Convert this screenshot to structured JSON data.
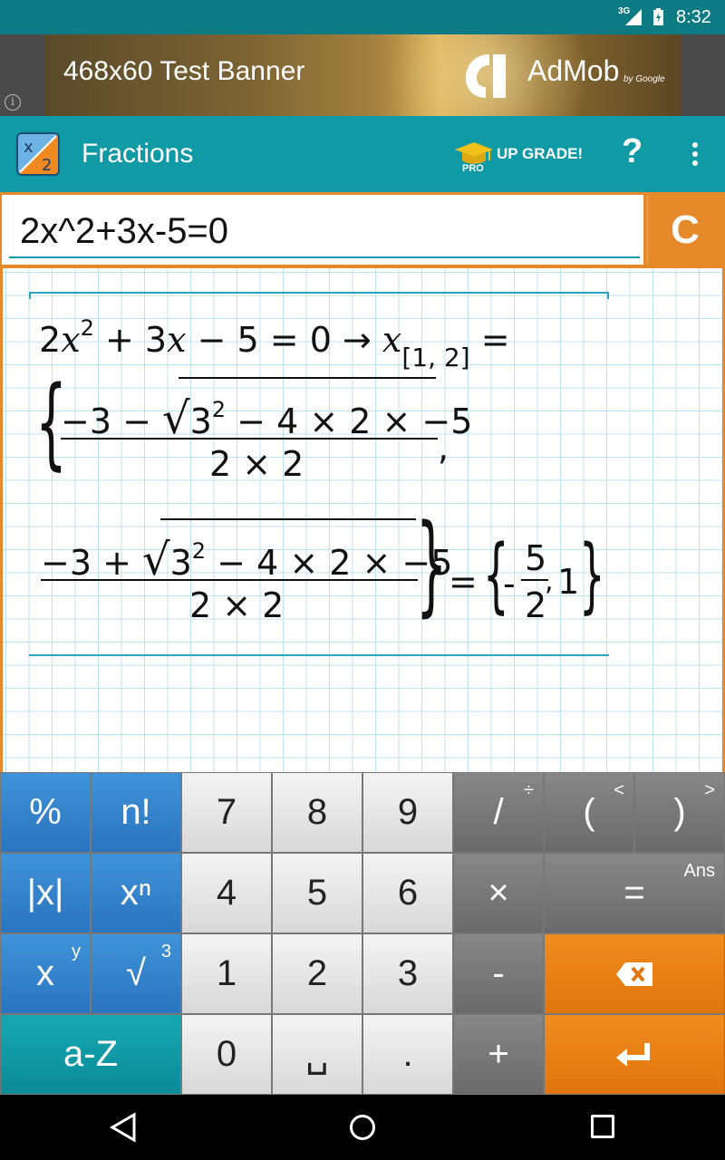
{
  "status_bar": {
    "network": "3G",
    "time": "8:32"
  },
  "ad": {
    "size_text": "468x60  Test Banner",
    "brand": "AdMob",
    "by": "by Google",
    "info": "i"
  },
  "app_bar": {
    "title": "Fractions",
    "upgrade_label": "UP GRADE!",
    "pro_label": "PRO",
    "help_label": "?"
  },
  "input": {
    "expression": "2x^2+3x-5=0",
    "clear_label": "C"
  },
  "result": {
    "line1": {
      "lhs_a": "2",
      "var": "x",
      "exp": "2",
      "rest": " + 3",
      "var2": "x",
      "rest2": " − 5 = 0  →  ",
      "xvar": "x",
      "sub": "[1, 2]",
      "eq": " ="
    },
    "frac1": {
      "numerator_left": "−3 − ",
      "radicand_base": "3",
      "radicand_exp": "2",
      "radicand_rest": " − 4 × 2 × −5",
      "denominator": "2 × 2",
      "comma": ","
    },
    "frac2": {
      "numerator_left": "−3 + ",
      "radicand_base": "3",
      "radicand_exp": "2",
      "radicand_rest": " − 4 × 2 × −5",
      "denominator": "2 × 2"
    },
    "answer": {
      "equals": "=",
      "minus": "-",
      "num": "5",
      "den": "2",
      "sep": ",",
      "second": "1"
    }
  },
  "keypad": {
    "rows": [
      [
        {
          "label": "%",
          "style": "blue"
        },
        {
          "label": "n!",
          "style": "blue"
        },
        {
          "label": "7",
          "style": "light"
        },
        {
          "label": "8",
          "style": "light"
        },
        {
          "label": "9",
          "style": "light"
        },
        {
          "label": "/",
          "corner": "÷",
          "style": "grey"
        },
        {
          "label": "(",
          "corner": "<",
          "style": "grey"
        },
        {
          "label": ")",
          "corner": ">",
          "style": "grey"
        }
      ],
      [
        {
          "label": "|x|",
          "style": "blue"
        },
        {
          "label": "xⁿ",
          "style": "blue"
        },
        {
          "label": "4",
          "style": "light"
        },
        {
          "label": "5",
          "style": "light"
        },
        {
          "label": "6",
          "style": "light"
        },
        {
          "label": "×",
          "style": "grey"
        },
        {
          "label": "=",
          "corner": "Ans",
          "style": "grey"
        }
      ],
      [
        {
          "label": "x",
          "corner": "y",
          "style": "blue"
        },
        {
          "label": "√",
          "corner": "3",
          "style": "blue"
        },
        {
          "label": "1",
          "style": "light"
        },
        {
          "label": "2",
          "style": "light"
        },
        {
          "label": "3",
          "style": "light"
        },
        {
          "label": "-",
          "style": "grey"
        },
        {
          "label": "backspace",
          "style": "orange"
        }
      ],
      [
        {
          "label": "a-Z",
          "style": "teal"
        },
        {
          "label": "0",
          "style": "light"
        },
        {
          "label": "␣",
          "style": "light"
        },
        {
          "label": ".",
          "style": "light"
        },
        {
          "label": "+",
          "style": "grey"
        },
        {
          "label": "enter",
          "style": "orange"
        }
      ]
    ]
  },
  "colors": {
    "accent": "#109aa6",
    "orange": "#e6892a",
    "status": "#0e7b84"
  }
}
